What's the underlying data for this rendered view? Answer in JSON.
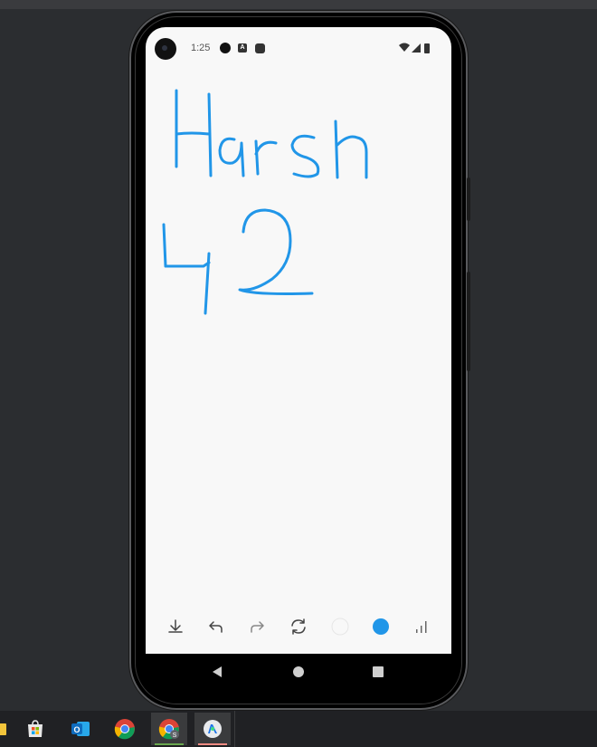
{
  "status_bar": {
    "time": "1:25",
    "notification_icons": [
      "dot-icon",
      "a-icon",
      "app-icon"
    ],
    "system_icons": [
      "wifi-icon",
      "signal-icon",
      "battery-icon"
    ]
  },
  "canvas": {
    "stroke_color": "#2196e8",
    "handwritten_text": [
      "Harsh",
      "42"
    ]
  },
  "toolbar": {
    "items": [
      {
        "name": "download-icon"
      },
      {
        "name": "undo-icon"
      },
      {
        "name": "redo-icon"
      },
      {
        "name": "refresh-icon"
      },
      {
        "name": "white-color-swatch",
        "color": "#f8f8f8"
      },
      {
        "name": "blue-color-swatch",
        "color": "#2196e8"
      },
      {
        "name": "stroke-width-icon"
      }
    ]
  },
  "nav_bar": {
    "items": [
      "back-icon",
      "home-icon",
      "recents-icon"
    ]
  },
  "taskbar": {
    "apps": [
      "file-explorer-icon",
      "microsoft-store-icon",
      "outlook-icon",
      "chrome-icon",
      "chrome-profile-icon",
      "android-studio-icon"
    ]
  },
  "colors": {
    "accent": "#2196e8",
    "screen_bg": "#f8f8f8",
    "desktop_bg": "#2b2d30"
  }
}
